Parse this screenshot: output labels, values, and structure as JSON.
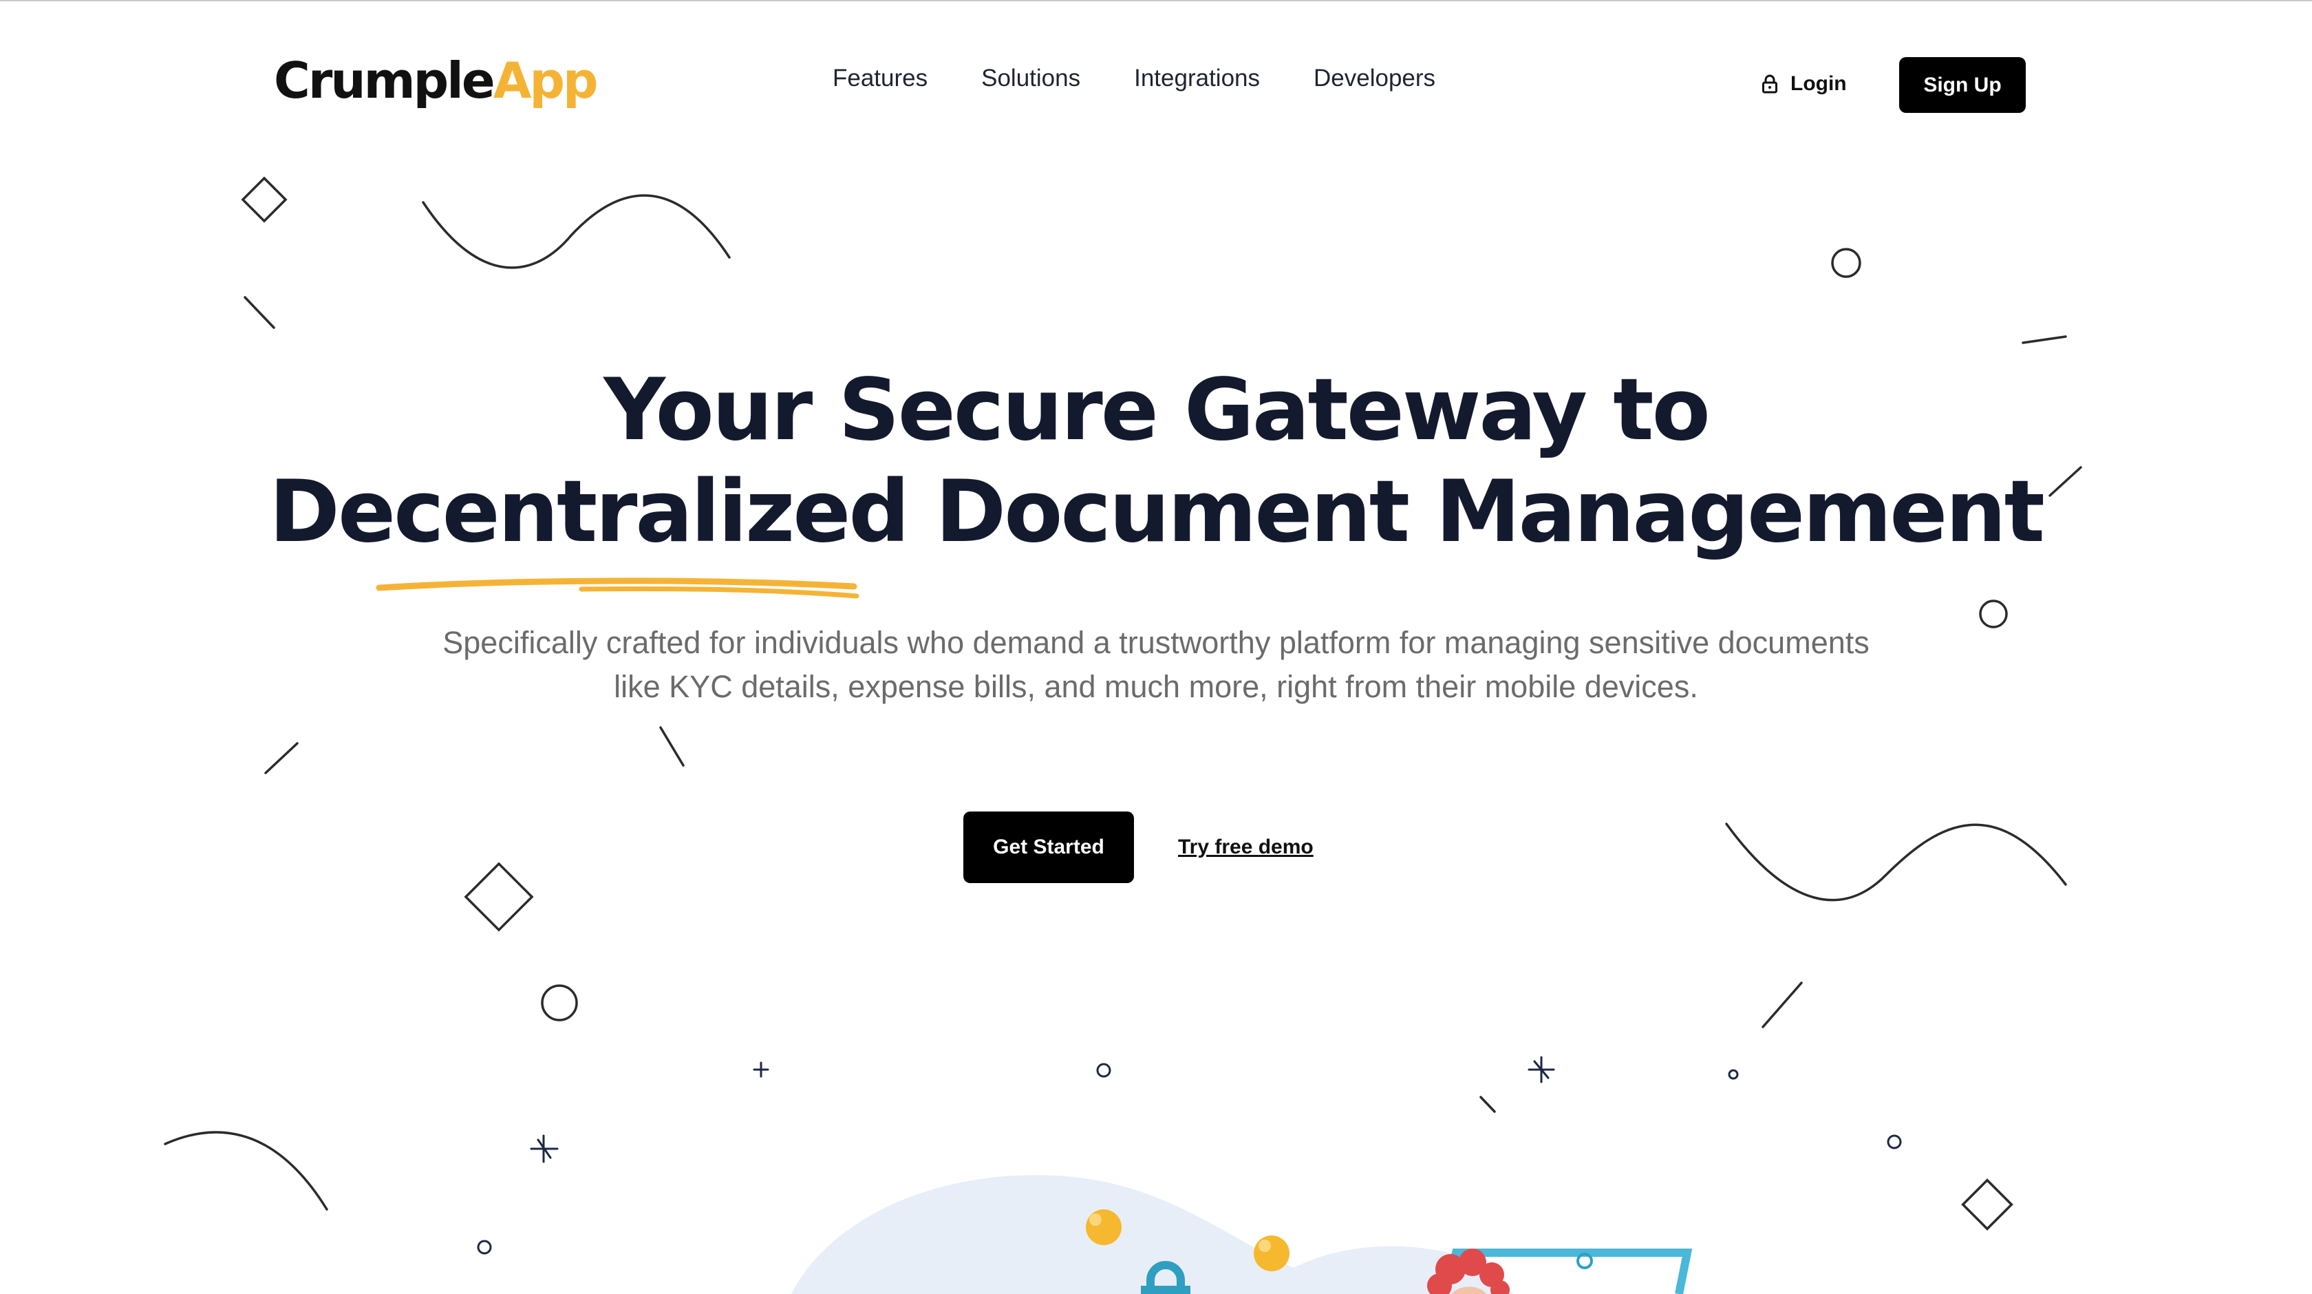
{
  "brand": {
    "name_part1": "Crumple",
    "name_part2": "App",
    "accent_color": "#f5b336"
  },
  "nav": {
    "items": [
      {
        "label": "Features"
      },
      {
        "label": "Solutions"
      },
      {
        "label": "Integrations"
      },
      {
        "label": "Developers"
      }
    ],
    "login_label": "Login",
    "login_icon": "lock-icon",
    "signup_label": "Sign Up"
  },
  "hero": {
    "title_line1": "Your Secure Gateway to",
    "title_line2": "Decentralized Document Management",
    "description": "Specifically crafted for individuals who demand a trustworthy platform for managing sensitive documents like KYC details, expense bills, and much more, right from their mobile devices.",
    "primary_cta": "Get Started",
    "secondary_cta": "Try free demo"
  },
  "colors": {
    "heading": "#141a2e",
    "body_text": "#6b6b6b",
    "button_bg": "#000000",
    "illustration_blob": "#e8eef8",
    "coin": "#f5b82e",
    "lock": "#2f9fc0",
    "hair": "#e04a4a"
  }
}
